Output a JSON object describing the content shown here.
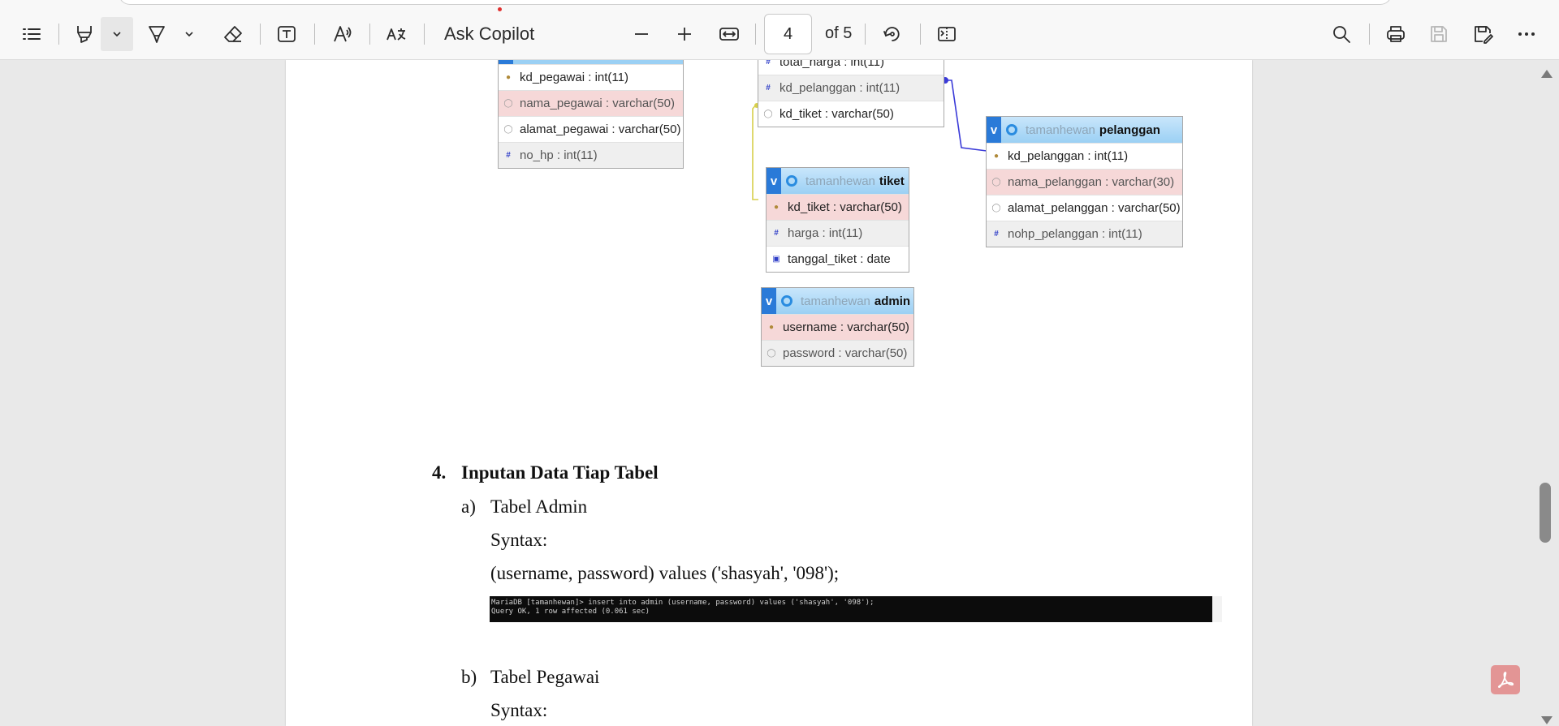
{
  "toolbar": {
    "ask_copilot": "Ask Copilot",
    "page_number": "4",
    "page_of": "of 5"
  },
  "doc": {
    "tables": {
      "pegawai": {
        "rows": [
          {
            "icon": "key-icon",
            "text": "kd_pegawai : int(11)"
          },
          {
            "icon": "text-field-icon",
            "text": "nama_pegawai : varchar(50)"
          },
          {
            "icon": "text-field-icon",
            "text": "alamat_pegawai : varchar(50)"
          },
          {
            "icon": "number-field-icon",
            "text": "no_hp : int(11)"
          }
        ]
      },
      "transaksi": {
        "rows": [
          {
            "icon": "number-field-icon",
            "text": "total_harga : int(11)"
          },
          {
            "icon": "number-field-icon",
            "text": "kd_pelanggan : int(11)"
          },
          {
            "icon": "text-field-icon",
            "text": "kd_tiket : varchar(50)"
          }
        ]
      },
      "pelanggan": {
        "schema": "tamanhewan",
        "name": "pelanggan",
        "rows": [
          {
            "icon": "key-icon",
            "text": "kd_pelanggan : int(11)"
          },
          {
            "icon": "text-field-icon",
            "text": "nama_pelanggan : varchar(30)"
          },
          {
            "icon": "text-field-icon",
            "text": "alamat_pelanggan : varchar(50)"
          },
          {
            "icon": "number-field-icon",
            "text": "nohp_pelanggan : int(11)"
          }
        ]
      },
      "tiket": {
        "schema": "tamanhewan",
        "name": "tiket",
        "rows": [
          {
            "icon": "key-icon",
            "text": "kd_tiket : varchar(50)"
          },
          {
            "icon": "number-field-icon",
            "text": "harga : int(11)"
          },
          {
            "icon": "date-field-icon",
            "text": "tanggal_tiket : date"
          }
        ]
      },
      "admin": {
        "schema": "tamanhewan",
        "name": "admin",
        "rows": [
          {
            "icon": "key-icon",
            "text": "username : varchar(50)"
          },
          {
            "icon": "text-field-icon",
            "text": "password : varchar(50)"
          }
        ]
      },
      "header_v": "v"
    },
    "section_number": "4.",
    "section_title": "Inputan Data Tiap Tabel",
    "sub_a_mark": "a)",
    "sub_a_title": "Tabel Admin",
    "sub_a_syntax_label": "Syntax:",
    "sub_a_syntax": "(username, password) values ('shasyah', '098');",
    "terminal_line1": "MariaDB [tamanhewan]> insert into admin (username, password) values ('shasyah', '098');",
    "terminal_line2": "Query OK, 1 row affected (0.061 sec)",
    "sub_b_mark": "b)",
    "sub_b_title": "Tabel Pegawai",
    "sub_b_syntax_label": "Syntax:"
  },
  "colors": {
    "header_accent": "#2a7ad8",
    "row_pink": "#f6d8d8",
    "row_grey": "#efefef",
    "link_green": "#3bbf3b",
    "link_yellow": "#d7cf4b",
    "link_blue": "#3a3ad8"
  }
}
